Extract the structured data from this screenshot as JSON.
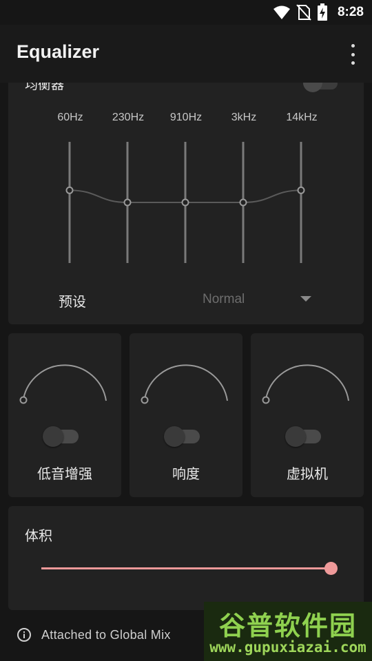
{
  "status_bar": {
    "time": "8:28",
    "icons": [
      "wifi-icon",
      "no-sim-icon",
      "battery-charging-icon"
    ]
  },
  "app_bar": {
    "title": "Equalizer",
    "menu_icon": "more-vert-icon"
  },
  "equalizer": {
    "label": "均衡器",
    "enabled": false,
    "bands": [
      {
        "label": "60Hz",
        "level": 0.6
      },
      {
        "label": "230Hz",
        "level": 0.5
      },
      {
        "label": "910Hz",
        "level": 0.5
      },
      {
        "label": "3kHz",
        "level": 0.5
      },
      {
        "label": "14kHz",
        "level": 0.6
      }
    ],
    "preset_label": "预设",
    "preset_value": "Normal"
  },
  "effects": [
    {
      "label": "低音增强",
      "enabled": false,
      "knob_value": 0
    },
    {
      "label": "响度",
      "enabled": false,
      "knob_value": 0
    },
    {
      "label": "虚拟机",
      "enabled": false,
      "knob_value": 0
    }
  ],
  "volume": {
    "label": "体积",
    "level": 1.0
  },
  "footer": {
    "text": "Attached to Global Mix",
    "icon": "info-icon"
  },
  "watermark": {
    "title": "谷普软件园",
    "url": "www.gupuxiazai.com"
  },
  "colors": {
    "accent": "#ef9a9a",
    "background": "#161616",
    "card": "#222222"
  }
}
